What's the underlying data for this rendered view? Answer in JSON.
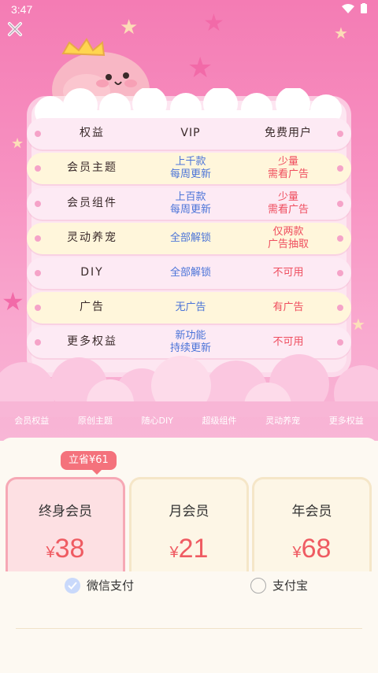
{
  "status": {
    "time": "3:47"
  },
  "colors": {
    "accent": "#f47cb4",
    "price": "#ef5b62",
    "vip_text": "#4b74d8",
    "free_text": "#ef4d5e"
  },
  "table": {
    "header": {
      "c1": "权益",
      "c2": "VIP",
      "c3": "免费用户"
    },
    "rows": [
      {
        "c1": "会员主题",
        "c2a": "上千款",
        "c2b": "每周更新",
        "c3a": "少量",
        "c3b": "需看广告"
      },
      {
        "c1": "会员组件",
        "c2a": "上百款",
        "c2b": "每周更新",
        "c3a": "少量",
        "c3b": "需看广告"
      },
      {
        "c1": "灵动养宠",
        "c2a": "全部解锁",
        "c2b": "",
        "c3a": "仅两款",
        "c3b": "广告抽取"
      },
      {
        "c1": "DIY",
        "c2a": "全部解锁",
        "c2b": "",
        "c3a": "不可用",
        "c3b": ""
      },
      {
        "c1": "广告",
        "c2a": "无广告",
        "c2b": "",
        "c3a": "有广告",
        "c3b": ""
      },
      {
        "c1": "更多权益",
        "c2a": "新功能",
        "c2b": "持续更新",
        "c3a": "不可用",
        "c3b": ""
      }
    ]
  },
  "tabs": [
    "会员权益",
    "原创主题",
    "随心DIY",
    "超级组件",
    "灵动养宠",
    "更多权益"
  ],
  "badge": "立省¥61",
  "plans": [
    {
      "name": "终身会员",
      "currency": "¥",
      "price": "38"
    },
    {
      "name": "月会员",
      "currency": "¥",
      "price": "21"
    },
    {
      "name": "年会员",
      "currency": "¥",
      "price": "68"
    }
  ],
  "payment": {
    "wechat": "微信支付",
    "alipay": "支付宝"
  }
}
